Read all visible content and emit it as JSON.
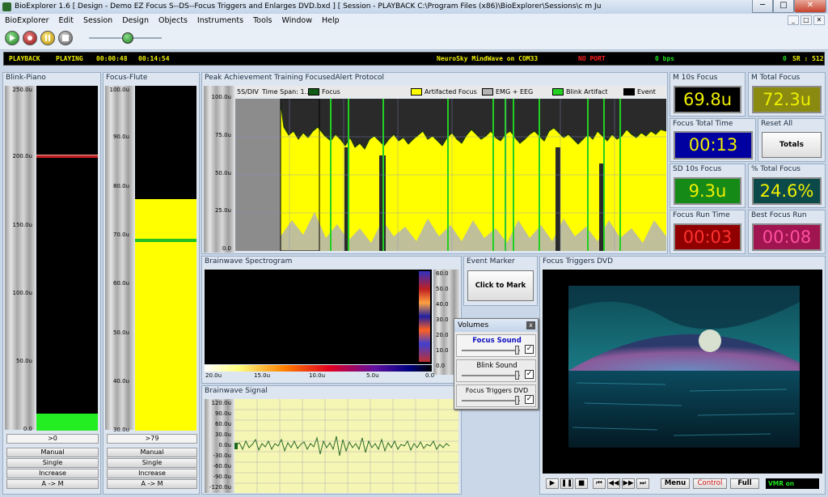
{
  "window": {
    "title": "BioExplorer 1.6  [ Design - Demo EZ Focus S--DS--Focus  Triggers and Enlarges DVD.bxd ] [ Session - PLAYBACK C:\\Program Files (x86)\\BioExplorer\\Sessions\\c m Ju",
    "minimize_label": "─",
    "maximize_label": "□",
    "close_label": "✕"
  },
  "menu": [
    "BioExplorer",
    "Edit",
    "Session",
    "Design",
    "Objects",
    "Instruments",
    "Tools",
    "Window",
    "Help"
  ],
  "mdi_buttons": [
    "_",
    "□",
    "✕"
  ],
  "status": {
    "mode": "PLAYBACK",
    "state": "PLAYING",
    "elapsed": "00:00:48",
    "total": "00:14:54",
    "device": "NeuroSky MindWave on COM33",
    "port": "NO PORT",
    "rate": "0 bps",
    "counter": "0",
    "sr": "SR : 512"
  },
  "blink_piano": {
    "title": "Blink-Piano",
    "ticks": [
      "250.0u",
      "200.0u",
      "150.0u",
      "100.0u",
      "50.0u",
      "0.0"
    ],
    "threshold_label": ">0",
    "buttons": [
      "Manual",
      "Single",
      "Increase",
      "A -> M"
    ],
    "level_fraction": 0.05,
    "threshold_fraction": 0.8
  },
  "focus_flute": {
    "title": "Focus-Flute",
    "ticks": [
      "100.0u",
      "90.0u",
      "80.0u",
      "70.0u",
      "60.0u",
      "50.0u",
      "40.0u",
      "30.0u"
    ],
    "threshold_label": ">79",
    "buttons": [
      "Manual",
      "Single",
      "Increase",
      "A -> M"
    ]
  },
  "peak_chart": {
    "title": "Peak Achievement Training FocusedAlert Protocol",
    "time_div": "5S/DIV",
    "time_span": "Time Span: 1...",
    "legend": [
      {
        "name": "Focus",
        "color": "#0f5a14"
      },
      {
        "name": "Artifacted Focus",
        "color": "#ffff00"
      },
      {
        "name": "EMG + EEG",
        "color": "#b4b4b4"
      },
      {
        "name": "Blink Artifact",
        "color": "#22d022"
      },
      {
        "name": "Event Marker",
        "color": "#000000"
      }
    ],
    "ticks": [
      "100.0u",
      "75.0u",
      "50.0u",
      "25.0u",
      "0.0"
    ]
  },
  "meters": {
    "m10s_focus": {
      "label": "M 10s Focus",
      "value": "69.8u",
      "bg": "#000000",
      "fg": "#f0f000"
    },
    "m_total_focus": {
      "label": "M Total Focus",
      "value": "72.3u",
      "bg": "#8a8a10",
      "fg": "#f0f000"
    },
    "focus_total_time": {
      "label": "Focus Total Time",
      "value": "00:13",
      "bg": "#0000a0",
      "fg": "#f0f000"
    },
    "reset_all": {
      "label": "Reset All",
      "button": "Totals"
    },
    "sd10s_focus": {
      "label": "SD 10s Focus",
      "value": "9.3u",
      "bg": "#168a16",
      "fg": "#f0f000"
    },
    "pct_total_focus": {
      "label": "% Total Focus",
      "value": "24.6%",
      "bg": "#0c4a4a",
      "fg": "#f0f000"
    },
    "focus_run_time": {
      "label": "Focus Run Time",
      "value": "00:03",
      "bg": "#900000",
      "fg": "#ff3030"
    },
    "best_focus_run": {
      "label": "Best Focus Run",
      "value": "00:08",
      "bg": "#a01450",
      "fg": "#ff50a0"
    }
  },
  "spectrogram": {
    "title": "Brainwave Spectrogram",
    "x_ticks": [
      "20.0u",
      "15.0u",
      "10.0u",
      "5.0u",
      "0.0"
    ],
    "y_ticks": [
      "60.0",
      "50.0",
      "40.0",
      "30.0",
      "20.0",
      "10.0",
      "0.0"
    ]
  },
  "event_marker": {
    "title": "Event Marker",
    "button": "Click to Mark"
  },
  "signal": {
    "title": "Brainwave Signal",
    "ticks": [
      "120.0u",
      "90.0u",
      "60.0u",
      "30.0u",
      "0.0u",
      "-30.0u",
      "-60.0u",
      "-90.0u",
      "-120.0u"
    ]
  },
  "volumes": {
    "title": "Volumes",
    "close": "x",
    "items": [
      {
        "name": "Focus Sound",
        "checked": "✓"
      },
      {
        "name": "Blink Sound",
        "checked": "✓"
      },
      {
        "name": "Focus Triggers DVD",
        "checked": "✓"
      }
    ]
  },
  "dvd": {
    "title": "Focus Triggers DVD",
    "controls": [
      "▶",
      "❚❚",
      "■",
      "⏮",
      "◀◀",
      "▶▶",
      "⏭"
    ],
    "menu": "Menu",
    "control": "Control",
    "full": "Full",
    "vmr": "VMR on"
  }
}
